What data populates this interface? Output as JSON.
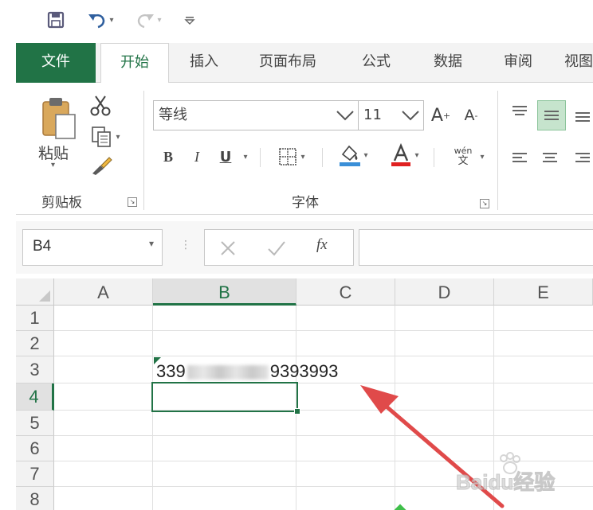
{
  "qat": {
    "save_icon": "save-icon",
    "undo_icon": "undo-icon",
    "redo_icon": "redo-icon",
    "customize_icon": "customize-qat-icon"
  },
  "tabs": [
    {
      "label": "文件"
    },
    {
      "label": "开始"
    },
    {
      "label": "插入"
    },
    {
      "label": "页面布局"
    },
    {
      "label": "公式"
    },
    {
      "label": "数据"
    },
    {
      "label": "审阅"
    },
    {
      "label": "视图"
    }
  ],
  "clipboard": {
    "paste_label": "粘贴",
    "group_label": "剪贴板"
  },
  "font": {
    "font_name": "等线",
    "font_size": "11",
    "bold": "B",
    "italic": "I",
    "underline": "U",
    "grow": "A",
    "shrink": "A",
    "wen_top": "wén",
    "wen_bottom": "文",
    "group_label": "字体"
  },
  "formula_bar": {
    "name_box": "B4",
    "fx": "fx",
    "content": ""
  },
  "sheet": {
    "columns": [
      "A",
      "B",
      "C",
      "D",
      "E"
    ],
    "rows": [
      "1",
      "2",
      "3",
      "4",
      "5",
      "6",
      "7",
      "8"
    ],
    "selected_cell": "B4",
    "b3_prefix": "339",
    "b3_suffix": "9393993"
  },
  "watermark": "Baidu经验",
  "colors": {
    "accent": "#217346",
    "arrow": "#e04a4a"
  }
}
